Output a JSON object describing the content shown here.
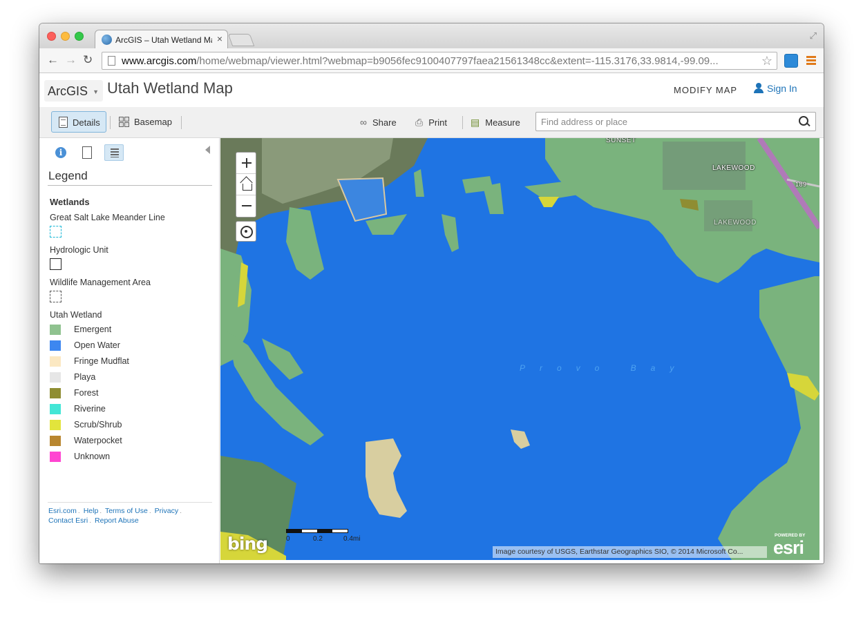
{
  "browser": {
    "tab_title": "ArcGIS – Utah Wetland Map",
    "url_host": "www.arcgis.com",
    "url_path": "/home/webmap/viewer.html?webmap=b9056fec9100407797faea21561348cc&extent=-115.3176,33.9814,-99.09..."
  },
  "header": {
    "brand": "ArcGIS",
    "map_title": "Utah Wetland Map",
    "modify_label": "MODIFY MAP",
    "signin_label": "Sign In"
  },
  "toolbar": {
    "details_label": "Details",
    "basemap_label": "Basemap",
    "share_label": "Share",
    "print_label": "Print",
    "measure_label": "Measure",
    "search_placeholder": "Find address or place"
  },
  "legend": {
    "title": "Legend",
    "layer_title": "Wetlands",
    "meander_label": "Great Salt Lake Meander Line",
    "huc_label": "Hydrologic Unit",
    "wma_label": "Wildlife Management Area",
    "wetland_title": "Utah Wetland",
    "classes": [
      {
        "label": "Emergent",
        "color": "#8fc28f"
      },
      {
        "label": "Open Water",
        "color": "#3d87f0"
      },
      {
        "label": "Fringe Mudflat",
        "color": "#fbe8c2"
      },
      {
        "label": "Playa",
        "color": "#e6e6e6"
      },
      {
        "label": "Forest",
        "color": "#8f8d32"
      },
      {
        "label": "Riverine",
        "color": "#43e6d6"
      },
      {
        "label": "Scrub/Shrub",
        "color": "#e2e43c"
      },
      {
        "label": "Waterpocket",
        "color": "#b8862f"
      },
      {
        "label": "Unknown",
        "color": "#ff45d1"
      }
    ]
  },
  "footer": {
    "esri": "Esri.com",
    "help": "Help",
    "terms": "Terms of Use",
    "privacy": "Privacy",
    "contact": "Contact Esri",
    "abuse": "Report Abuse"
  },
  "map": {
    "labels": {
      "sunset": "SUNSET",
      "lakewood1": "LAKEWOOD",
      "lakewood2": "LAKEWOOD",
      "bay": "Provo Bay",
      "route": "189"
    },
    "scale_0": "0",
    "scale_mid": "0.2",
    "scale_end": "0.4mi",
    "bing": "bing",
    "attribution": "Image courtesy of USGS, Earthstar Geographics SIO, © 2014 Microsoft Co...",
    "powered_by": "POWERED BY",
    "esri_logo": "esri"
  }
}
